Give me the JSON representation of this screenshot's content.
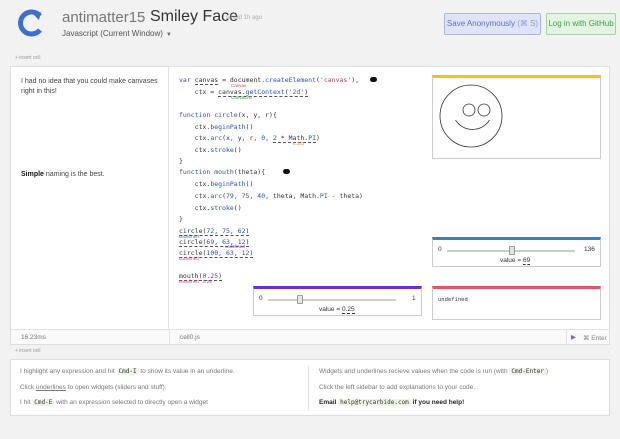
{
  "header": {
    "username": "antimatter15",
    "separator": "›",
    "notebook_title": "Smiley Face",
    "saved_status": "saved 1h ago",
    "language": "Javascript (Current Window)",
    "save_button": "Save Anonymously",
    "save_shortcut": "(⌘ S)",
    "login_button": "Log in with GitHub"
  },
  "insert_cell_label": "+ insert cell",
  "cell": {
    "notes": [
      "I had no idea that you could make canvases right in this!",
      "naming is the best."
    ],
    "note_bold": "Simple",
    "code_lines": {
      "l1": "var canvas = document.createElement('canvas'),",
      "l2": "    ctx = canvas.getContext('2d')",
      "l3": "function circle(x, y, r){",
      "l4": "    ctx.beginPath()",
      "l5": "    ctx.arc(x, y, r, 0, 2 * Math.PI)",
      "l6": "    ctx.stroke()",
      "l7": "}",
      "l8": "function mouth(theta){",
      "l9": "    ctx.beginPath()",
      "l10": "    ctx.arc(79, 75, 40, theta, Math.PI - theta)",
      "l11": "    ctx.stroke()",
      "l12": "}",
      "l13": "circle(72, 75, 62)",
      "l14": "circle(69, 63, 12)",
      "l15": "circle(100, 63, 12)",
      "l16": "mouth(0.25)"
    },
    "annotations": {
      "canvas": "Canvas",
      "ctx": "Canvas2D",
      "pi2": "6.283",
      "undef1": "undefined",
      "undef2": "undefined",
      "undef3": "undefined",
      "undef4": "undefined",
      "mouth_val": "0.25"
    },
    "slider_top": {
      "min": "0",
      "max": "136",
      "label": "value = ",
      "value": "69",
      "fraction": 0.507
    },
    "slider_bottom": {
      "min": "0",
      "max": "1",
      "label": "value = ",
      "value": "0.25",
      "fraction": 0.25
    },
    "output_undefined": "undefined",
    "footer": {
      "time": "16.23ms",
      "filename": "cell0.js",
      "run_icon": "▶",
      "run_shortcut": "⌘ Enter"
    },
    "colors": {
      "canvas_accent": "#f0c419",
      "slider_top_accent": "#2f7fd4",
      "slider_bottom_accent": "#6b2fd6",
      "undefined_accent": "#e05a5a"
    }
  },
  "help": {
    "left": {
      "line1_a": "I highlight any expression and hit",
      "line1_kbd": "Cmd-I",
      "line1_b": "to show its value in an underline.",
      "line2_a": "Click",
      "line2_link": "underlines",
      "line2_b": "to open widgets (sliders and stuff).",
      "line3_a": "I hit",
      "line3_kbd": "Cmd-E",
      "line3_b": "with an expression selected to directly open a widget"
    },
    "right": {
      "line1_a": "Widgets and underlines recieve values when the code is run (with",
      "line1_kbd": "Cmd-Enter",
      "line1_b": ")",
      "line2": "Click the left sidebar to add explanations to your code.",
      "line3_a": "Email",
      "line3_email": "help@trycarbide.com",
      "line3_b": "if you need help!"
    }
  }
}
